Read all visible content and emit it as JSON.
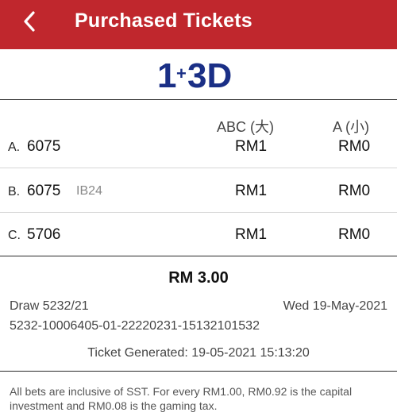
{
  "header": {
    "title": "Purchased Tickets",
    "back_icon": "chevron-left-icon",
    "background": "#c0272d"
  },
  "logo": {
    "text": "1+3D",
    "color": "#1a2f86"
  },
  "columns": {
    "abc": "ABC (大)",
    "a": "A (小)"
  },
  "rows": [
    {
      "letter": "A.",
      "number": "6075",
      "tag": "",
      "abc": "RM1",
      "a": "RM0"
    },
    {
      "letter": "B.",
      "number": "6075",
      "tag": "IB24",
      "abc": "RM1",
      "a": "RM0"
    },
    {
      "letter": "C.",
      "number": "5706",
      "tag": "",
      "abc": "RM1",
      "a": "RM0"
    }
  ],
  "summary": {
    "total": "RM 3.00",
    "draw": "Draw 5232/21",
    "draw_date": "Wed 19-May-2021",
    "serial": "5232-10006405-01-22220231-15132101532",
    "generated": "Ticket Generated: 19-05-2021 15:13:20"
  },
  "footer": {
    "note": "All bets are inclusive of SST. For every RM1.00, RM0.92 is the capital investment and RM0.08 is the gaming tax."
  }
}
